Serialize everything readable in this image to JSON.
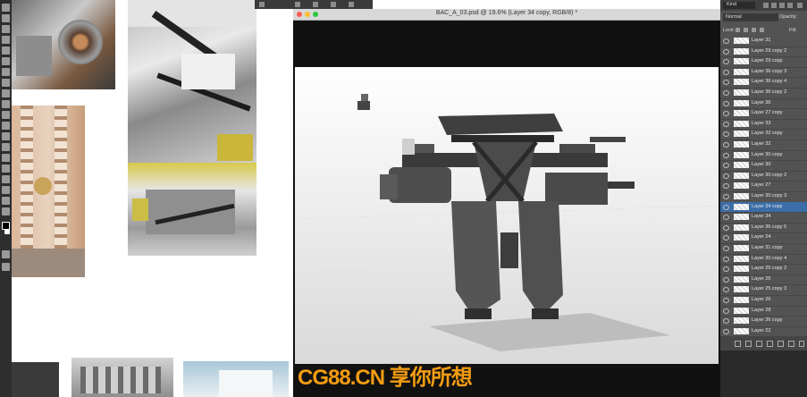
{
  "document": {
    "title": "BAC_A_03.psd @ 19.6% (Layer 34 copy, RGB/8) *"
  },
  "layers_panel": {
    "filter_label": "Kind",
    "blend_mode": "Normal",
    "opacity_label": "Opacity:",
    "fill_label": "Fill:",
    "lock_label": "Lock:",
    "selected_layer": "Layer 34 copy",
    "layers": [
      "Layer 31",
      "Layer 29 copy 2",
      "Layer 29 copy",
      "Layer 36 copy 3",
      "Layer 36 copy 4",
      "Layer 36 copy 2",
      "Layer 36",
      "Layer 27 copy",
      "Layer 33",
      "Layer 32 copy",
      "Layer 32",
      "Layer 30 copy",
      "Layer 30",
      "Layer 30 copy 2",
      "Layer 27",
      "Layer 30 copy 3",
      "Layer 34 copy",
      "Layer 34",
      "Layer 36 copy 5",
      "Layer 24",
      "Layer 31 copy",
      "Layer 30 copy 4",
      "Layer 25 copy 2",
      "Layer 25",
      "Layer 25 copy 3",
      "Layer 26",
      "Layer 28",
      "Layer 36 copy",
      "Layer 22"
    ]
  },
  "watermark": {
    "text": "CG88.CN 享你所想"
  },
  "colors": {
    "panel": "#535353",
    "selection": "#3b6ea8",
    "watermark": "#f39c12"
  }
}
